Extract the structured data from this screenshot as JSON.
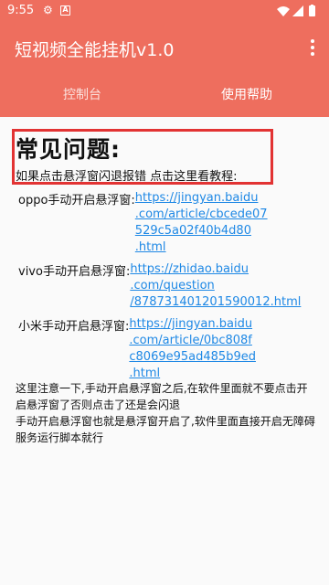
{
  "status_bar": {
    "time": "9:55",
    "icons": [
      "settings-icon",
      "a-box-icon",
      "wifi-icon",
      "signal-icon",
      "battery-icon"
    ]
  },
  "app_bar": {
    "title": "短视频全能挂机v1.0",
    "menu_icon": "more-vert-icon"
  },
  "tabs": [
    {
      "label": "控制台"
    },
    {
      "label": "使用帮助"
    }
  ],
  "help": {
    "heading": "常见问题:",
    "subheading": "如果点击悬浮窗闪退报错 点击这里看教程:",
    "entries": [
      {
        "label": "oppo手动开启悬浮窗:",
        "url_lines": [
          "https://jingyan.baidu",
          ".com/article/cbcede07",
          "529c5a02f40b4d80",
          ".html"
        ]
      },
      {
        "label": "vivo手动开启悬浮窗:",
        "url_lines": [
          "https://zhidao.baidu",
          ".com/question",
          "/878731401201590012.html"
        ]
      },
      {
        "label": "小米手动开启悬浮窗:",
        "url_lines": [
          "https://jingyan.baidu",
          ".com/article/0bc808f",
          "c8069e95ad485b9ed",
          ".html"
        ]
      }
    ],
    "notes": [
      "这里注意一下,手动开启悬浮窗之后,在软件里面就不要点击开启悬浮窗了否则点击了还是会闪退",
      "手动开启悬浮窗也就是悬浮窗开启了,软件里面直接开启无障碍服务运行脚本就行"
    ]
  },
  "colors": {
    "accent": "#ee6e5e",
    "link": "#1e88e5",
    "highlight_box": "#e23333"
  }
}
